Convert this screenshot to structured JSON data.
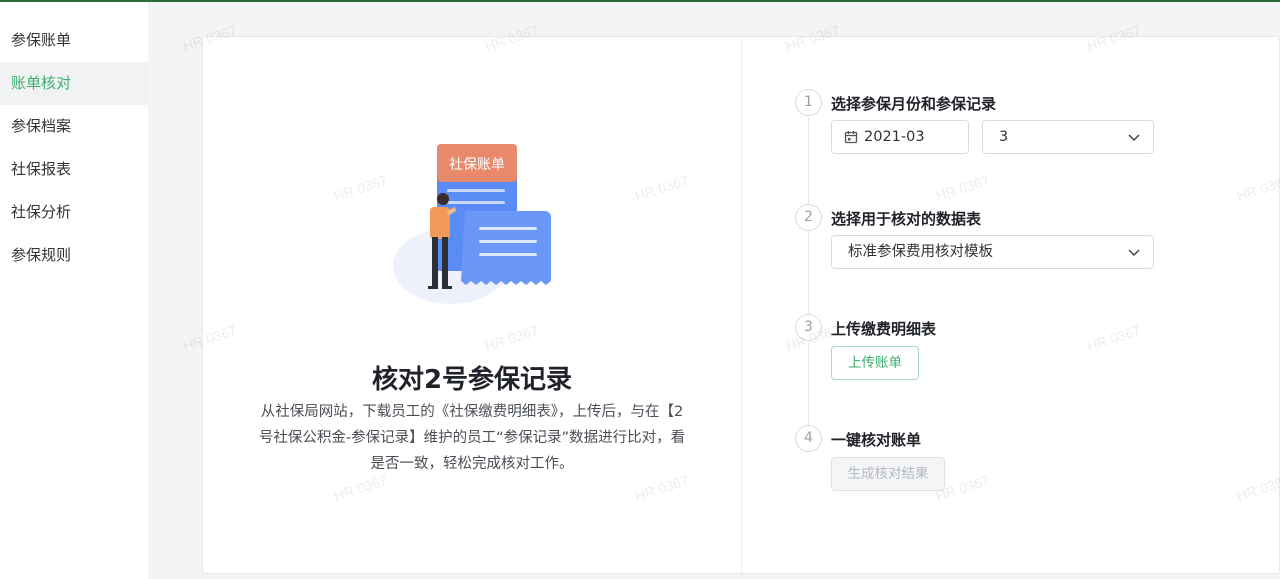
{
  "sidebar": {
    "items": [
      {
        "label": "参保账单"
      },
      {
        "label": "账单核对"
      },
      {
        "label": "参保档案"
      },
      {
        "label": "社保报表"
      },
      {
        "label": "社保分析"
      },
      {
        "label": "参保规则"
      }
    ],
    "active_index": 1
  },
  "left_panel": {
    "badge_text": "社保账单",
    "title": "核对2号参保记录",
    "description": "从社保局网站，下载员工的《社保缴费明细表》，上传后，与在【2号社保公积金-参保记录】维护的员工“参保记录”数据进行比对，看是否一致，轻松完成核对工作。"
  },
  "steps": [
    {
      "num": "1",
      "title": "选择参保月份和参保记录",
      "date_value": "2021-03",
      "record_value": "3"
    },
    {
      "num": "2",
      "title": "选择用于核对的数据表",
      "template_value": "标准参保费用核对模板"
    },
    {
      "num": "3",
      "title": "上传缴费明细表",
      "button": "上传账单"
    },
    {
      "num": "4",
      "title": "一键核对账单",
      "button": "生成核对结果"
    }
  ],
  "watermark": "HR 0367",
  "colors": {
    "accent": "#3eaf6f",
    "badge": "#e8896b",
    "doc_blue": "#5b8cf5",
    "person_shirt": "#f29a5a"
  },
  "icons": [
    "calendar-icon",
    "chevron-down-icon"
  ]
}
